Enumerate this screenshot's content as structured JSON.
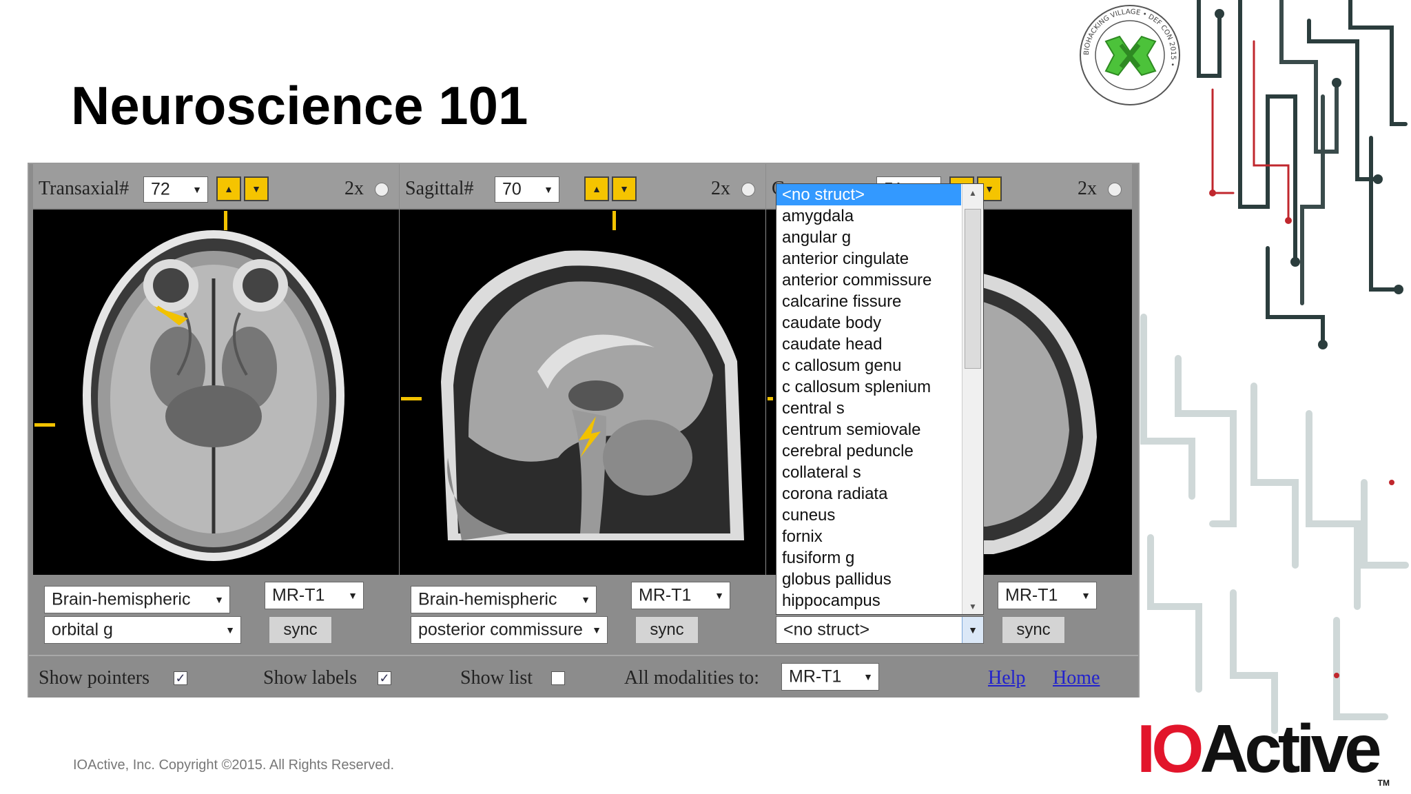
{
  "slide": {
    "title": "Neuroscience 101",
    "copyright": "IOActive, Inc. Copyright ©2015.  All Rights Reserved.",
    "logo_io": "IO",
    "logo_rest": "Active",
    "logo_mark": "TM",
    "seal_text": "BIOHACKING VILLAGE • DEF CON 2015 •"
  },
  "viewer": {
    "panels": [
      {
        "label": "Transaxial#",
        "slice": "72",
        "zoom": "2x",
        "atlas": "Brain-hemispheric",
        "structure": "orbital g",
        "modality": "MR-T1",
        "sync": "sync"
      },
      {
        "label": "Sagittal#",
        "slice": "70",
        "zoom": "2x",
        "atlas": "Brain-hemispheric",
        "structure": "posterior commissure",
        "modality": "MR-T1",
        "sync": "sync"
      },
      {
        "label": "C",
        "slice": "51",
        "zoom": "2x",
        "atlas": "",
        "structure": "<no struct>",
        "modality": "MR-T1",
        "sync": "sync"
      }
    ],
    "bottom": {
      "show_pointers": "Show pointers",
      "show_labels": "Show labels",
      "show_list": "Show list",
      "all_modalities": "All modalities to:",
      "all_modalities_value": "MR-T1",
      "help": "Help",
      "home": "Home",
      "show_pointers_checked": true,
      "show_labels_checked": true,
      "show_list_checked": false
    },
    "dropdown": {
      "selected": "<no struct>",
      "items": [
        "<no struct>",
        "amygdala",
        "angular g",
        "anterior cingulate",
        "anterior commissure",
        "calcarine fissure",
        "caudate body",
        "caudate head",
        "c callosum genu",
        "c callosum splenium",
        "central s",
        "centrum semiovale",
        "cerebral peduncle",
        "collateral s",
        "corona radiata",
        "cuneus",
        "fornix",
        "fusiform g",
        "globus pallidus",
        "hippocampus"
      ]
    }
  },
  "colors": {
    "accent_yellow": "#f2c200",
    "selection_blue": "#3399ff",
    "logo_red": "#e2152b",
    "link_blue": "#2222cc"
  }
}
